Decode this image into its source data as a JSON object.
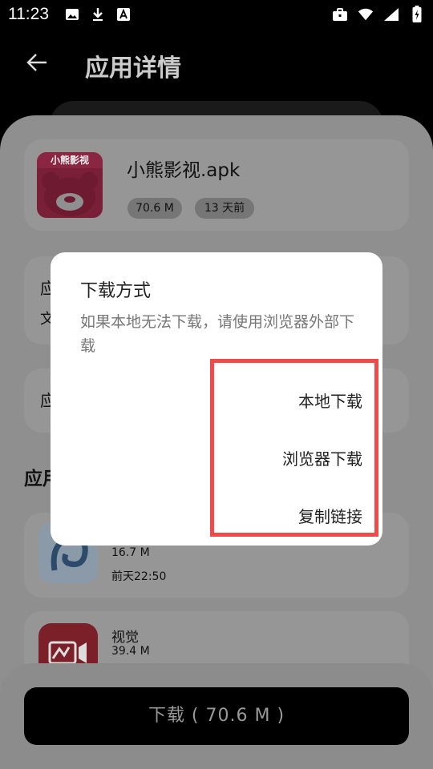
{
  "status_bar": {
    "time": "11:23"
  },
  "header": {
    "title": "应用详情"
  },
  "app": {
    "name": "小熊影视.apk",
    "size": "70.6 M",
    "age": "13 天前",
    "logo_text": "小熊影视"
  },
  "sections": {
    "partial1": "应",
    "partial1_sub": "文",
    "partial2": "应",
    "related": "应用"
  },
  "related_apps": [
    {
      "name": "",
      "size": "16.7 M",
      "time": "前天22:50"
    },
    {
      "name": "视觉",
      "size": "39.4 M"
    }
  ],
  "download_button": "下载 ( 70.6 M )",
  "dialog": {
    "title": "下载方式",
    "message": "如果本地无法下载，请使用浏览器外部下载",
    "options": [
      "本地下载",
      "浏览器下载",
      "复制链接"
    ]
  },
  "colors": {
    "highlight": "#f04a4a",
    "logo_red": "#e8205a"
  }
}
